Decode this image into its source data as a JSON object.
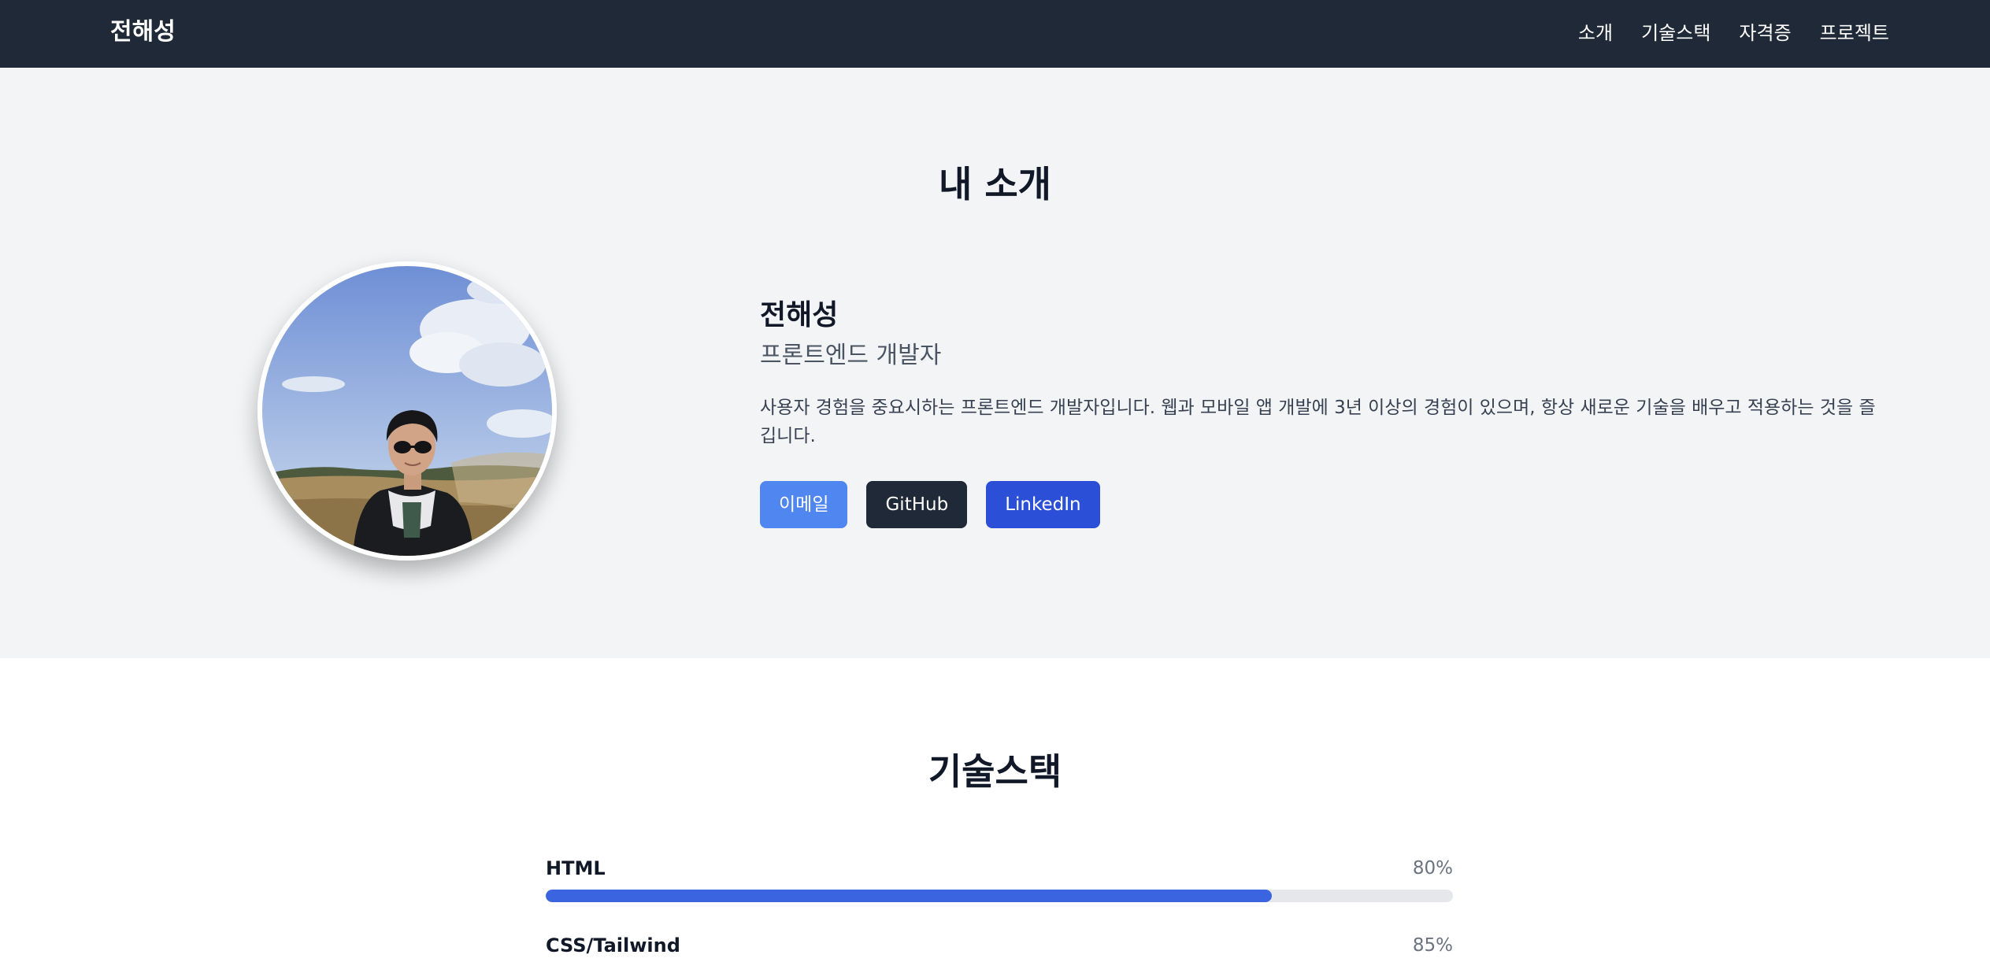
{
  "nav": {
    "brand": "전해성",
    "links": [
      "소개",
      "기술스택",
      "자격증",
      "프로젝트"
    ]
  },
  "about": {
    "title": "내 소개",
    "name": "전해성",
    "role": "프론트엔드 개발자",
    "bio": "사용자 경험을 중요시하는 프론트엔드 개발자입니다. 웹과 모바일 앱 개발에 3년 이상의 경험이 있으며, 항상 새로운 기술을 배우고 적용하는 것을 즐깁니다.",
    "buttons": {
      "email": "이메일",
      "github": "GitHub",
      "linkedin": "LinkedIn"
    }
  },
  "skills": {
    "title": "기술스택",
    "items": [
      {
        "label": "HTML",
        "percent_label": "80%",
        "level": 0.8
      },
      {
        "label": "CSS/Tailwind",
        "percent_label": "85%",
        "level": 0.85
      }
    ]
  },
  "colors": {
    "navbar_bg": "#1f2937",
    "hero_bg": "#f3f4f6",
    "email_btn": "#4f86ef",
    "github_btn": "#1f2937",
    "linkedin_btn": "#2b4fd6",
    "progress_fill": "#3a64e0",
    "progress_track": "#e5e7eb"
  }
}
